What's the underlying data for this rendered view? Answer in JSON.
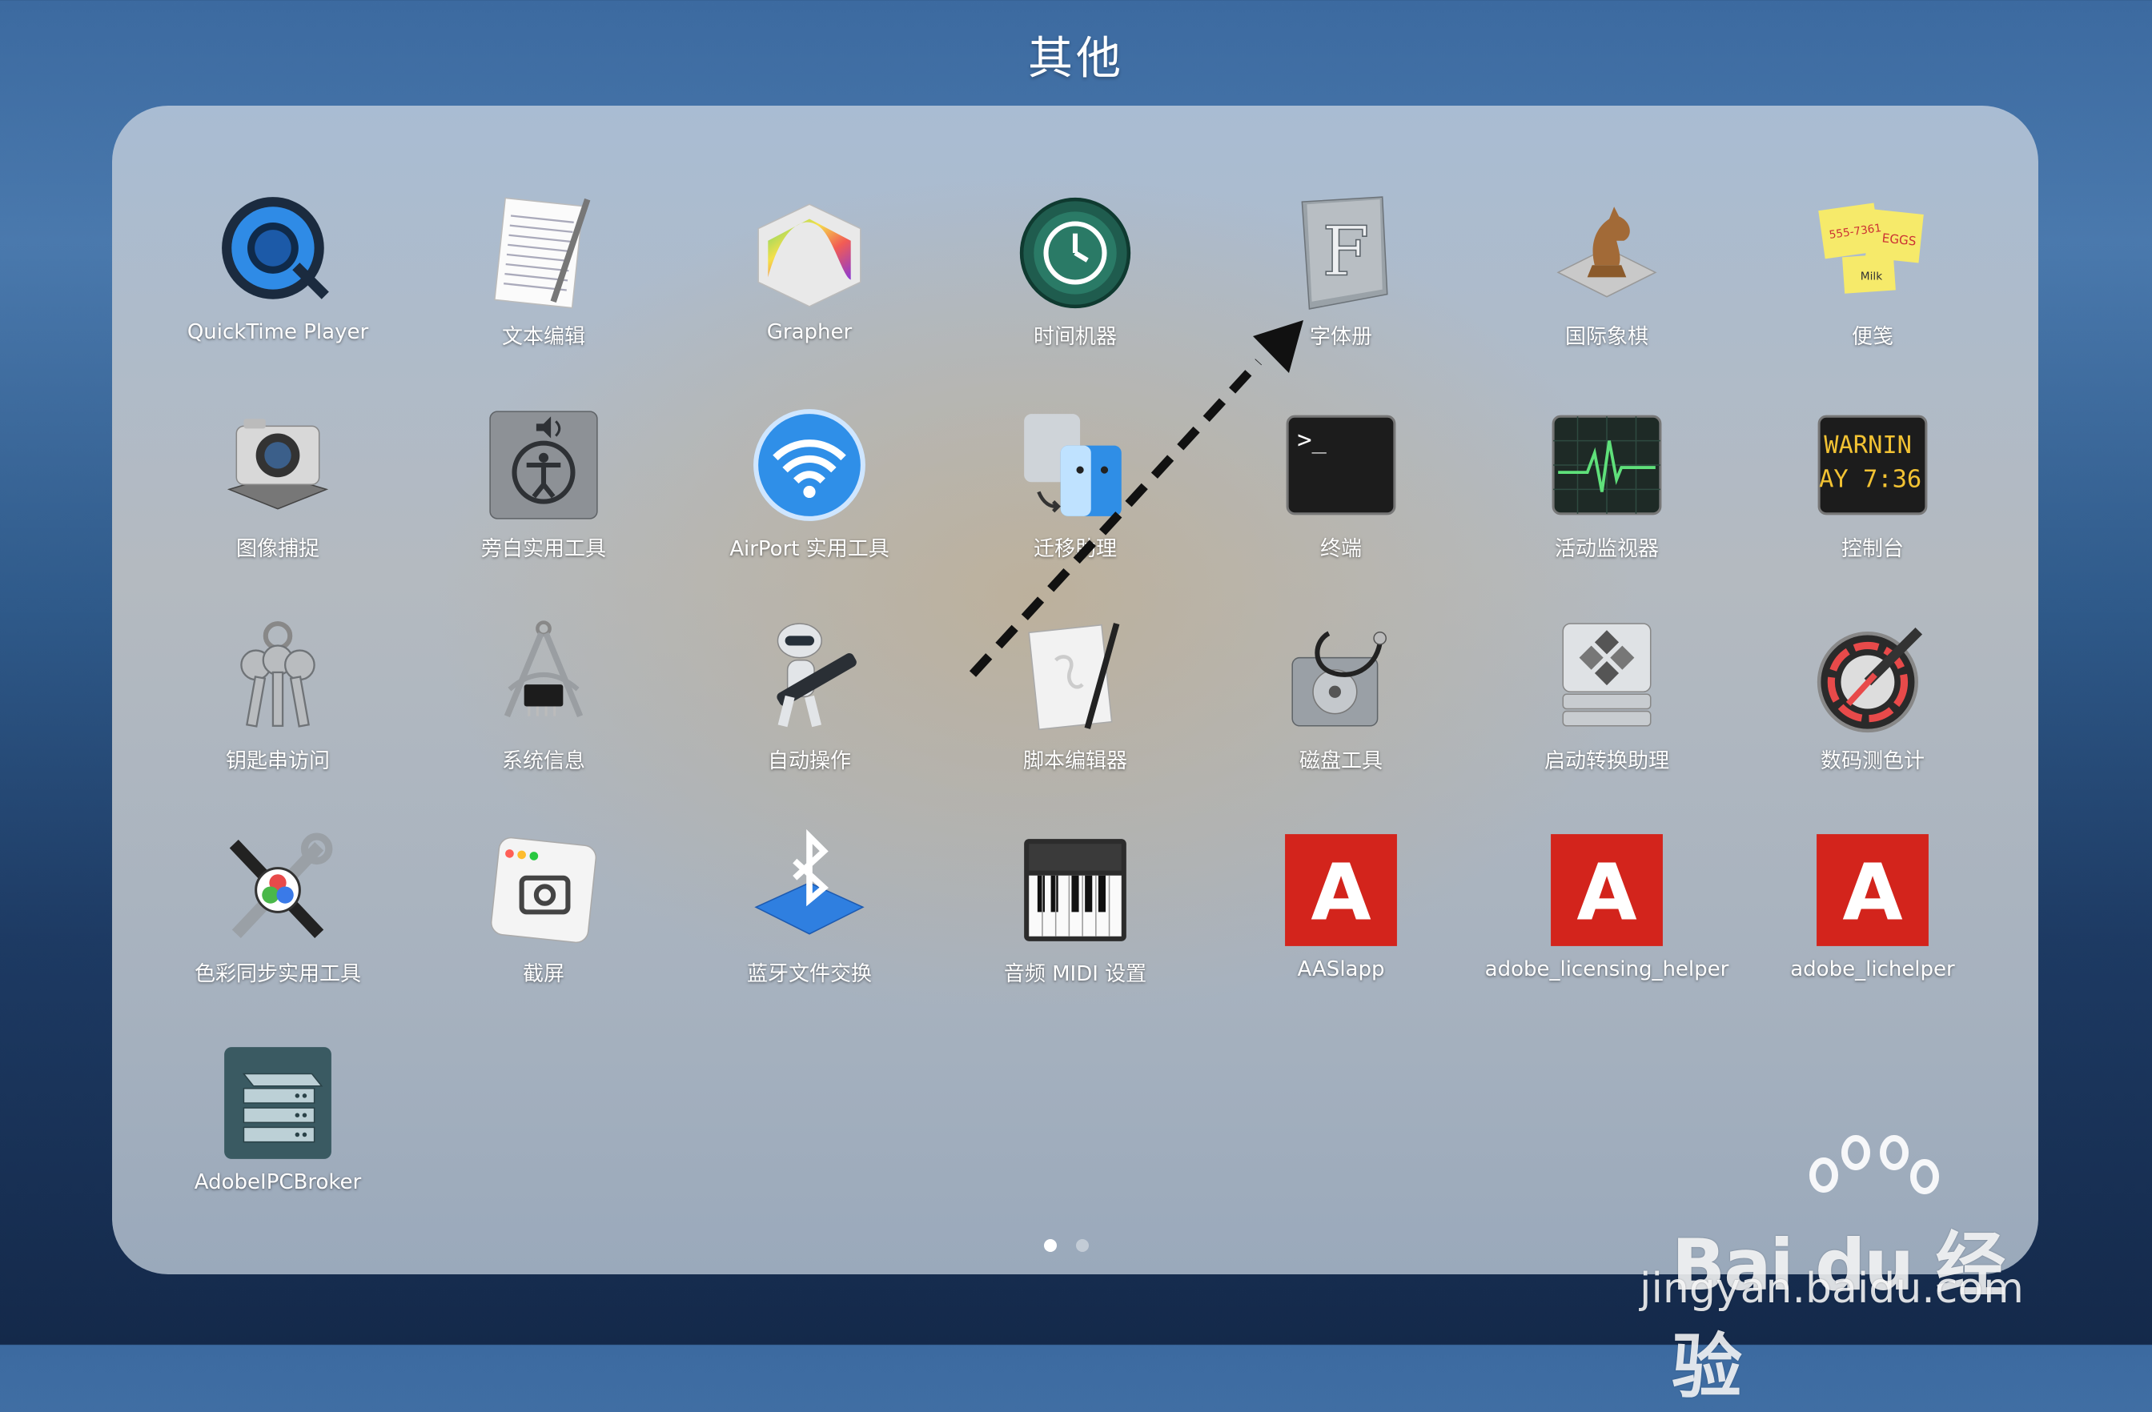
{
  "folder": {
    "title": "其他"
  },
  "apps": [
    {
      "label": "QuickTime Player",
      "icon": "quicktime-icon"
    },
    {
      "label": "文本编辑",
      "icon": "textedit-icon"
    },
    {
      "label": "Grapher",
      "icon": "grapher-icon"
    },
    {
      "label": "时间机器",
      "icon": "time-machine-icon"
    },
    {
      "label": "字体册",
      "icon": "font-book-icon"
    },
    {
      "label": "国际象棋",
      "icon": "chess-icon"
    },
    {
      "label": "便笺",
      "icon": "stickies-icon"
    },
    {
      "label": "图像捕捉",
      "icon": "image-capture-icon"
    },
    {
      "label": "旁白实用工具",
      "icon": "voiceover-utility-icon"
    },
    {
      "label": "AirPort 实用工具",
      "icon": "airport-utility-icon"
    },
    {
      "label": "迁移助理",
      "icon": "migration-assistant-icon"
    },
    {
      "label": "终端",
      "icon": "terminal-icon"
    },
    {
      "label": "活动监视器",
      "icon": "activity-monitor-icon"
    },
    {
      "label": "控制台",
      "icon": "console-icon"
    },
    {
      "label": "钥匙串访问",
      "icon": "keychain-access-icon"
    },
    {
      "label": "系统信息",
      "icon": "system-information-icon"
    },
    {
      "label": "自动操作",
      "icon": "automator-icon"
    },
    {
      "label": "脚本编辑器",
      "icon": "script-editor-icon"
    },
    {
      "label": "磁盘工具",
      "icon": "disk-utility-icon"
    },
    {
      "label": "启动转换助理",
      "icon": "boot-camp-icon"
    },
    {
      "label": "数码测色计",
      "icon": "digital-color-meter-icon"
    },
    {
      "label": "色彩同步实用工具",
      "icon": "colorsync-utility-icon"
    },
    {
      "label": "截屏",
      "icon": "screenshot-icon"
    },
    {
      "label": "蓝牙文件交换",
      "icon": "bluetooth-file-exchange-icon"
    },
    {
      "label": "音频 MIDI 设置",
      "icon": "audio-midi-setup-icon"
    },
    {
      "label": "AASlapp",
      "icon": "adobe-icon"
    },
    {
      "label": "adobe_licensing_helper",
      "icon": "adobe-icon"
    },
    {
      "label": "adobe_lichelper",
      "icon": "adobe-icon"
    },
    {
      "label": "AdobeIPCBroker",
      "icon": "adobe-ipc-broker-icon"
    }
  ],
  "console_icon_text": {
    "line1": "WARNIN",
    "line2": "AY 7:36"
  },
  "terminal_icon_text": ">_",
  "stickies_icon_text": {
    "line1": "555-7361",
    "line2": "EGGS",
    "line3": "Milk"
  },
  "font_book_icon_text": "F",
  "adobe_icon_text": "A",
  "pagination": {
    "current": 1,
    "total": 2
  },
  "watermark": {
    "logo": "Bai du 经验",
    "url": "jingyan.baidu.com"
  },
  "colors": {
    "adobe_red": "#d3241c",
    "terminal_bg": "#1c1c1c",
    "console_text": "#f2c233"
  }
}
